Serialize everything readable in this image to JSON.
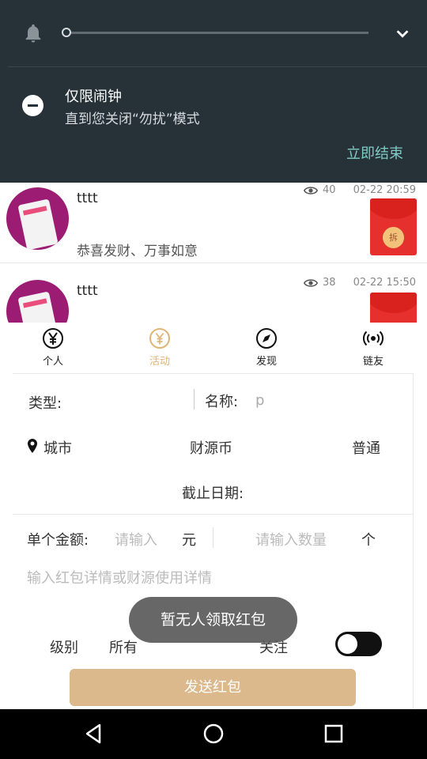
{
  "notification": {
    "title": "仅限闹钟",
    "subtitle": "直到您关闭“勿扰”模式",
    "end_button": "立即结束"
  },
  "feed": [
    {
      "name": "tttt",
      "views": "40",
      "time": "02-22 20:59",
      "message": "恭喜发财、万事如意",
      "packet_label": "拆"
    },
    {
      "name": "tttt",
      "views": "38",
      "time": "02-22 15:50",
      "message": ""
    }
  ],
  "tabs": [
    {
      "label": "个人",
      "icon": "yen-coin-icon",
      "active": false
    },
    {
      "label": "活动",
      "icon": "yen-circle-icon",
      "active": true
    },
    {
      "label": "发现",
      "icon": "compass-icon",
      "active": false
    },
    {
      "label": "链友",
      "icon": "broadcast-icon",
      "active": false
    }
  ],
  "form": {
    "type_label": "类型:",
    "name_label": "名称:",
    "name_value": "p",
    "city_label": "城市",
    "currency_label": "财源币",
    "mode_label": "普通",
    "deadline_label": "截止日期:",
    "amount_label": "单个金额:",
    "amount_placeholder": "请输入",
    "amount_unit": "元",
    "count_placeholder": "请输入数量",
    "count_unit": "个",
    "detail_placeholder": "输入红包详情或财源使用详情",
    "level_label": "级别",
    "level_value": "所有",
    "follow_label": "关注",
    "follow_on": false,
    "send_button": "发送红包"
  },
  "toast": "暂无人领取红包",
  "colors": {
    "shade_bg": "#263238",
    "accent_teal": "#7fcbc4",
    "active_tab": "#e0b477",
    "send_button_bg": "#dcb98d",
    "packet_red": "#e6302d"
  }
}
